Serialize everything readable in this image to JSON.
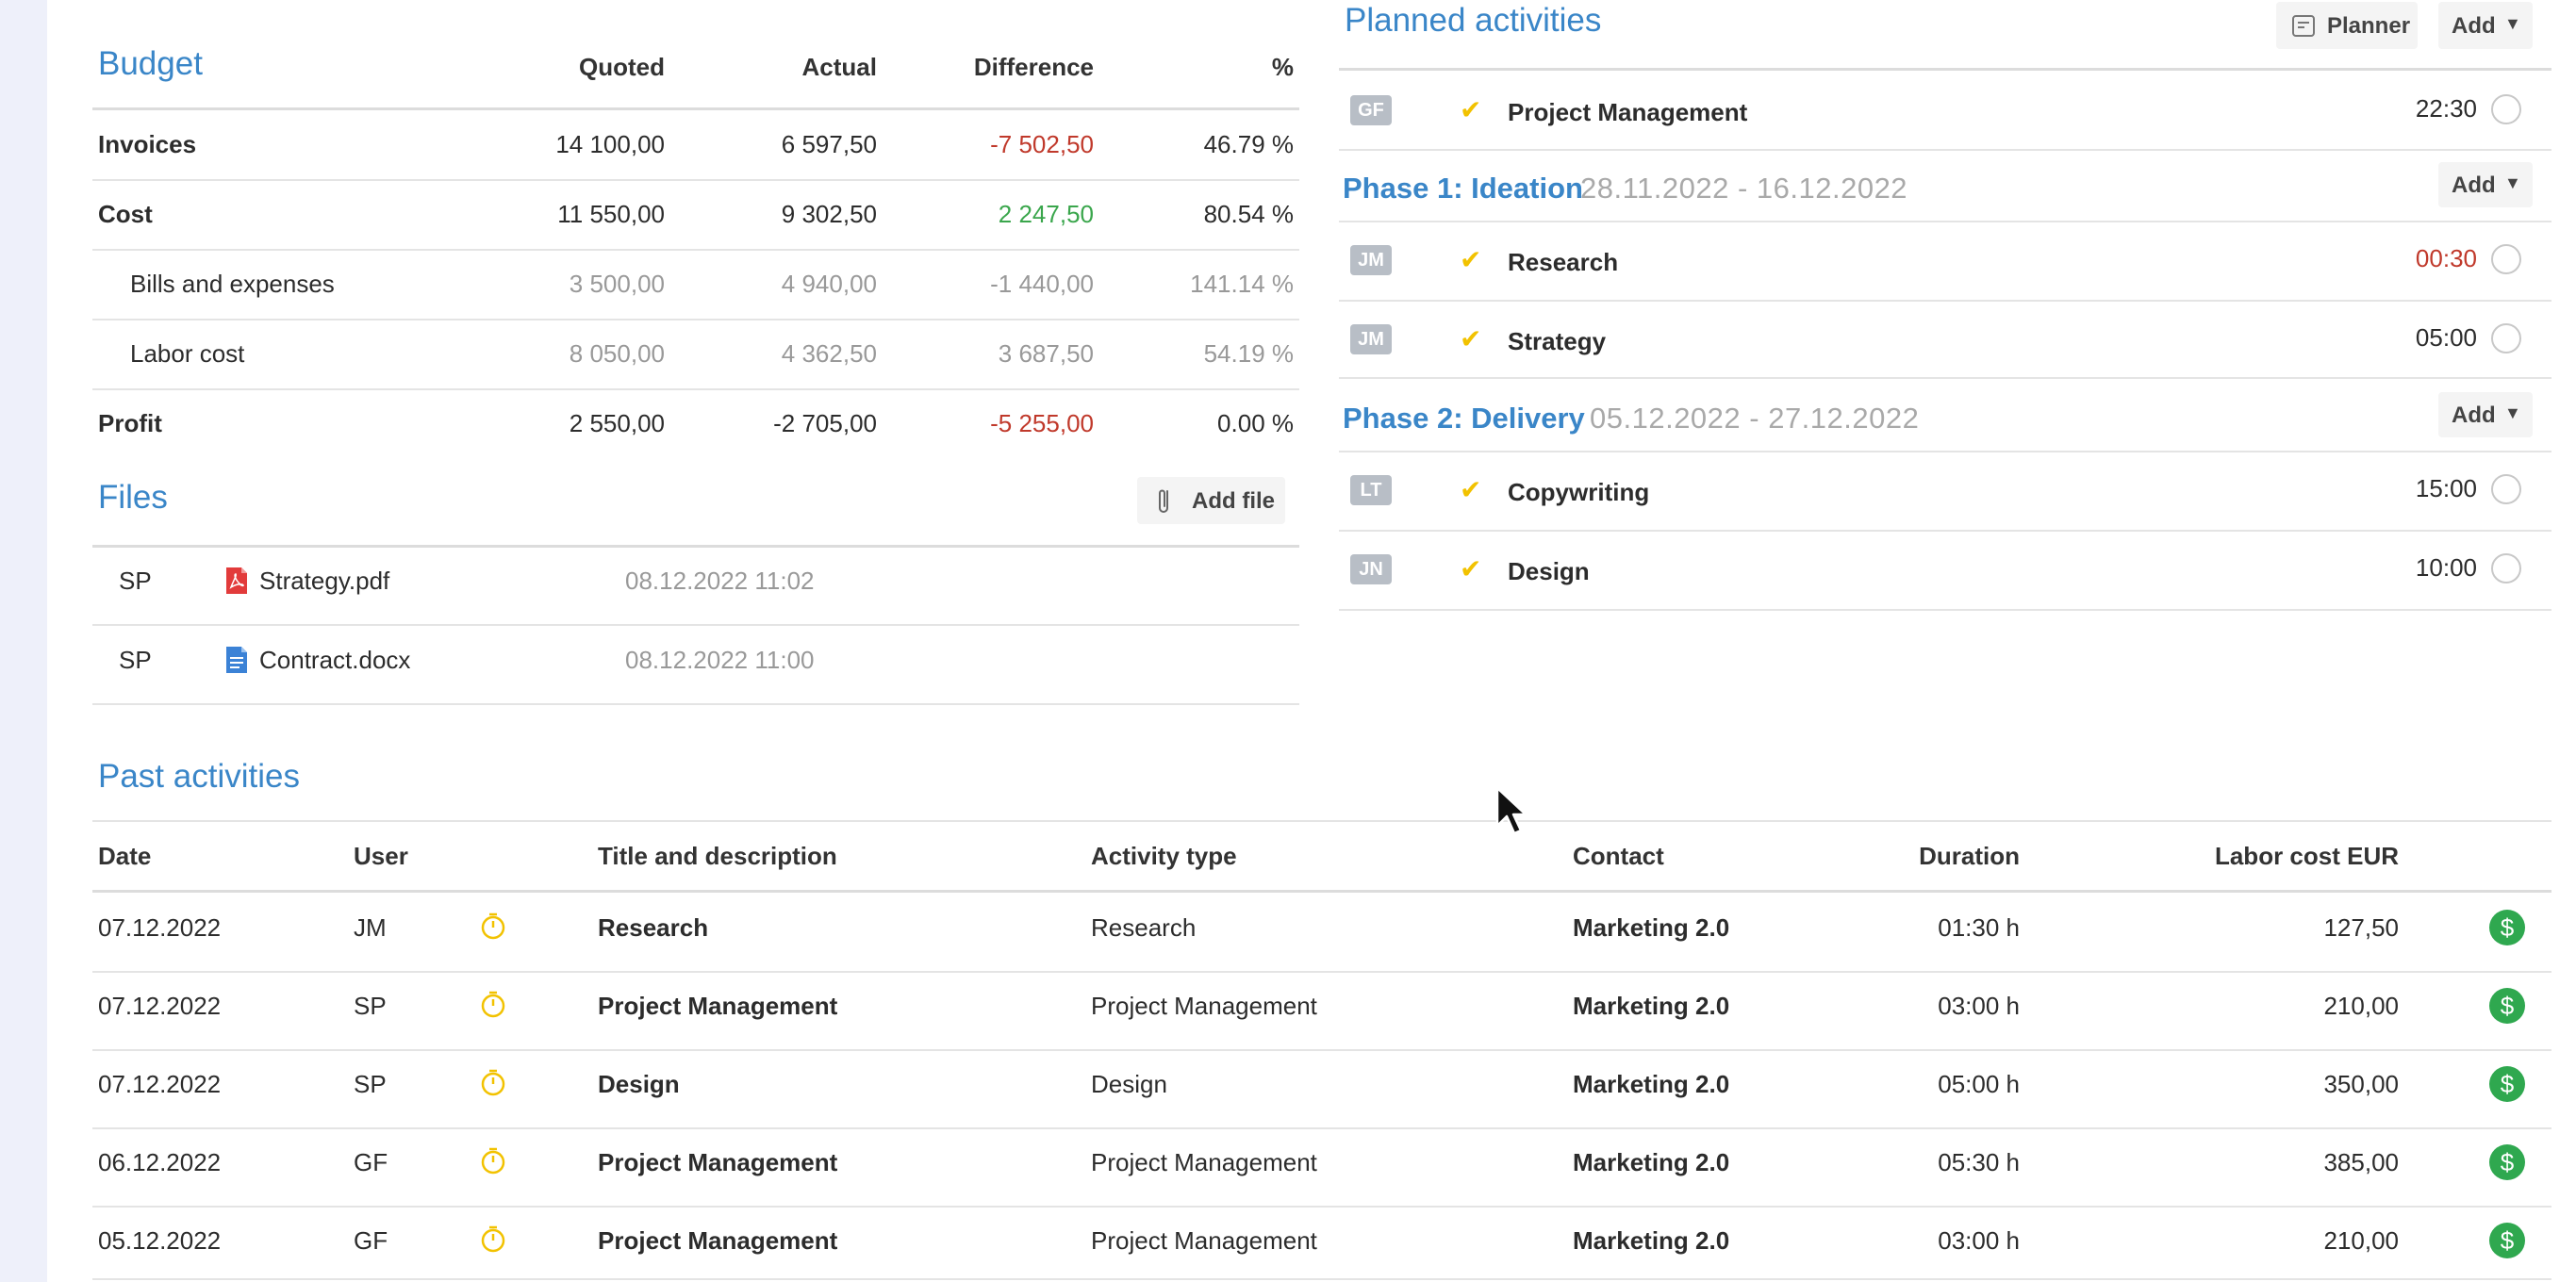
{
  "budget": {
    "title": "Budget",
    "headers": {
      "quoted": "Quoted",
      "actual": "Actual",
      "difference": "Difference",
      "percent": "%"
    },
    "rows": [
      {
        "label": "Invoices",
        "quoted": "14 100,00",
        "actual": "6 597,50",
        "difference": "-7 502,50",
        "percent": "46.79 %"
      },
      {
        "label": "Cost",
        "quoted": "11 550,00",
        "actual": "9 302,50",
        "difference": "2 247,50",
        "percent": "80.54 %"
      },
      {
        "label": "Bills and expenses",
        "quoted": "3 500,00",
        "actual": "4 940,00",
        "difference": "-1 440,00",
        "percent": "141.14 %"
      },
      {
        "label": "Labor cost",
        "quoted": "8 050,00",
        "actual": "4 362,50",
        "difference": "3 687,50",
        "percent": "54.19 %"
      },
      {
        "label": "Profit",
        "quoted": "2 550,00",
        "actual": "-2 705,00",
        "difference": "-5 255,00",
        "percent": "0.00 %"
      }
    ]
  },
  "files": {
    "title": "Files",
    "add_label": "Add file",
    "items": [
      {
        "user": "SP",
        "name": "Strategy.pdf",
        "date": "08.12.2022 11:02"
      },
      {
        "user": "SP",
        "name": "Contract.docx",
        "date": "08.12.2022 11:00"
      }
    ]
  },
  "planned": {
    "title": "Planned activities",
    "planner_label": "Planner",
    "add_label": "Add",
    "top_item": {
      "user": "GF",
      "title": "Project Management",
      "time": "22:30"
    },
    "phases": [
      {
        "title": "Phase 1: Ideation",
        "dates": "28.11.2022 - 16.12.2022",
        "add_label": "Add",
        "items": [
          {
            "user": "JM",
            "title": "Research",
            "time": "00:30"
          },
          {
            "user": "JM",
            "title": "Strategy",
            "time": "05:00"
          }
        ]
      },
      {
        "title": "Phase 2: Delivery",
        "dates": "05.12.2022 - 27.12.2022",
        "add_label": "Add",
        "items": [
          {
            "user": "LT",
            "title": "Copywriting",
            "time": "15:00"
          },
          {
            "user": "JN",
            "title": "Design",
            "time": "10:00"
          }
        ]
      }
    ]
  },
  "past": {
    "title": "Past activities",
    "headers": {
      "date": "Date",
      "user": "User",
      "title": "Title and description",
      "type": "Activity type",
      "contact": "Contact",
      "duration": "Duration",
      "cost": "Labor cost EUR"
    },
    "rows": [
      {
        "date": "07.12.2022",
        "user": "JM",
        "title": "Research",
        "type": "Research",
        "contact": "Marketing 2.0",
        "duration": "01:30 h",
        "cost": "127,50"
      },
      {
        "date": "07.12.2022",
        "user": "SP",
        "title": "Project Management",
        "type": "Project Management",
        "contact": "Marketing 2.0",
        "duration": "03:00 h",
        "cost": "210,00"
      },
      {
        "date": "07.12.2022",
        "user": "SP",
        "title": "Design",
        "type": "Design",
        "contact": "Marketing 2.0",
        "duration": "05:00 h",
        "cost": "350,00"
      },
      {
        "date": "06.12.2022",
        "user": "GF",
        "title": "Project Management",
        "type": "Project Management",
        "contact": "Marketing 2.0",
        "duration": "05:30 h",
        "cost": "385,00"
      },
      {
        "date": "05.12.2022",
        "user": "GF",
        "title": "Project Management",
        "type": "Project Management",
        "contact": "Marketing 2.0",
        "duration": "03:00 h",
        "cost": "210,00"
      }
    ]
  },
  "colors": {
    "accent": "#3a86c8",
    "negative": "#c0392b",
    "positive": "#3aa64c",
    "check": "#f2c200",
    "dollar": "#2fa84f"
  }
}
